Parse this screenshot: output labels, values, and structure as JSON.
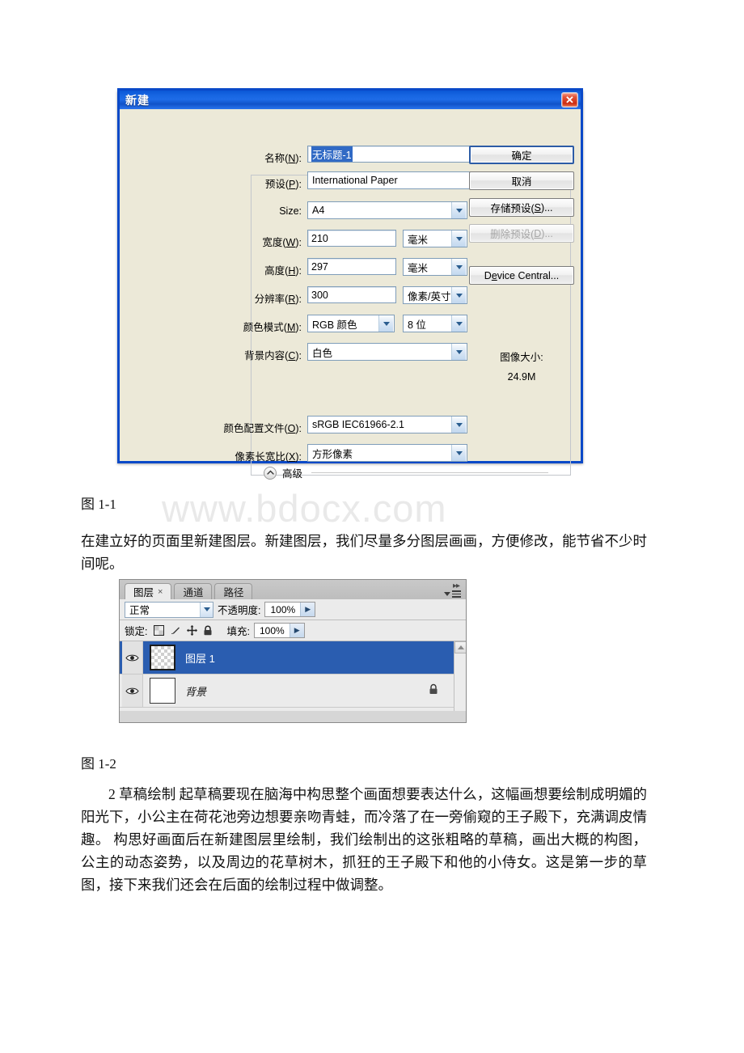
{
  "document": {
    "watermark": "www.bdocx.com",
    "figure1_caption": "图 1-1",
    "figure2_caption": "图 1-2",
    "paragraph1": "在建立好的页面里新建图层。新建图层，我们尽量多分图层画画，方便修改，能节省不少时间呢。",
    "paragraph2": "2 草稿绘制 起草稿要现在脑海中构思整个画面想要表达什么，这幅画想要绘制成明媚的阳光下，小公主在荷花池旁边想要亲吻青蛙，而冷落了在一旁偷窥的王子殿下，充满调皮情趣。 构思好画面后在新建图层里绘制，我们绘制出的这张粗略的草稿，画出大概的构图，公主的动态姿势，以及周边的花草树木，抓狂的王子殿下和他的小侍女。这是第一步的草图，接下来我们还会在后面的绘制过程中做调整。"
  },
  "new_dialog": {
    "title": "新建",
    "close_label": "✕",
    "name": {
      "label_prefix": "名称(",
      "label_key": "N",
      "label_suffix": "):",
      "value": "无标题-1"
    },
    "preset": {
      "label_prefix": "预设(",
      "label_key": "P",
      "label_suffix": "):",
      "value": "International Paper"
    },
    "size": {
      "label": "Size:",
      "value": "A4"
    },
    "width": {
      "label_prefix": "宽度(",
      "label_key": "W",
      "label_suffix": "):",
      "value": "210",
      "unit": "毫米"
    },
    "height": {
      "label_prefix": "高度(",
      "label_key": "H",
      "label_suffix": "):",
      "value": "297",
      "unit": "毫米"
    },
    "resolution": {
      "label_prefix": "分辨率(",
      "label_key": "R",
      "label_suffix": "):",
      "value": "300",
      "unit": "像素/英寸"
    },
    "color_mode": {
      "label_prefix": "颜色模式(",
      "label_key": "M",
      "label_suffix": "):",
      "value": "RGB 颜色",
      "depth": "8 位"
    },
    "background_contents": {
      "label_prefix": "背景内容(",
      "label_key": "C",
      "label_suffix": "):",
      "value": "白色"
    },
    "advanced": {
      "label": "高级",
      "expanded": true
    },
    "color_profile": {
      "label_prefix": "颜色配置文件(",
      "label_key": "O",
      "label_suffix": "):",
      "value": "sRGB IEC61966-2.1"
    },
    "pixel_aspect_ratio": {
      "label_prefix": "像素长宽比(",
      "label_key": "X",
      "label_suffix": "):",
      "value": "方形像素"
    },
    "buttons": {
      "ok": "确定",
      "cancel": "取消",
      "save_preset_prefix": "存储预设(",
      "save_preset_key": "S",
      "save_preset_suffix": ")...",
      "delete_preset_prefix": "删除预设(",
      "delete_preset_key": "D",
      "delete_preset_suffix": ")...",
      "device_central_prefix": "D",
      "device_central_key": "e",
      "device_central_suffix": "vice Central..."
    },
    "image_size": {
      "label": "图像大小:",
      "value": "24.9M"
    }
  },
  "layers_panel": {
    "tabs": [
      {
        "label": "图层",
        "close": "×",
        "active": true
      },
      {
        "label": "通道",
        "active": false
      },
      {
        "label": "路径",
        "active": false
      }
    ],
    "blend_mode": "正常",
    "opacity_label": "不透明度:",
    "opacity_value": "100%",
    "lock_label": "锁定:",
    "fill_label": "填充:",
    "fill_value": "100%",
    "lock_icons": [
      "lock-transparency-icon",
      "lock-image-icon",
      "lock-position-icon",
      "lock-all-icon"
    ],
    "layers": [
      {
        "name": "图层 1",
        "selected": true,
        "thumb": "transparent",
        "locked": false,
        "italic": false
      },
      {
        "name": "背景",
        "selected": false,
        "thumb": "white",
        "locked": true,
        "italic": true
      }
    ]
  }
}
